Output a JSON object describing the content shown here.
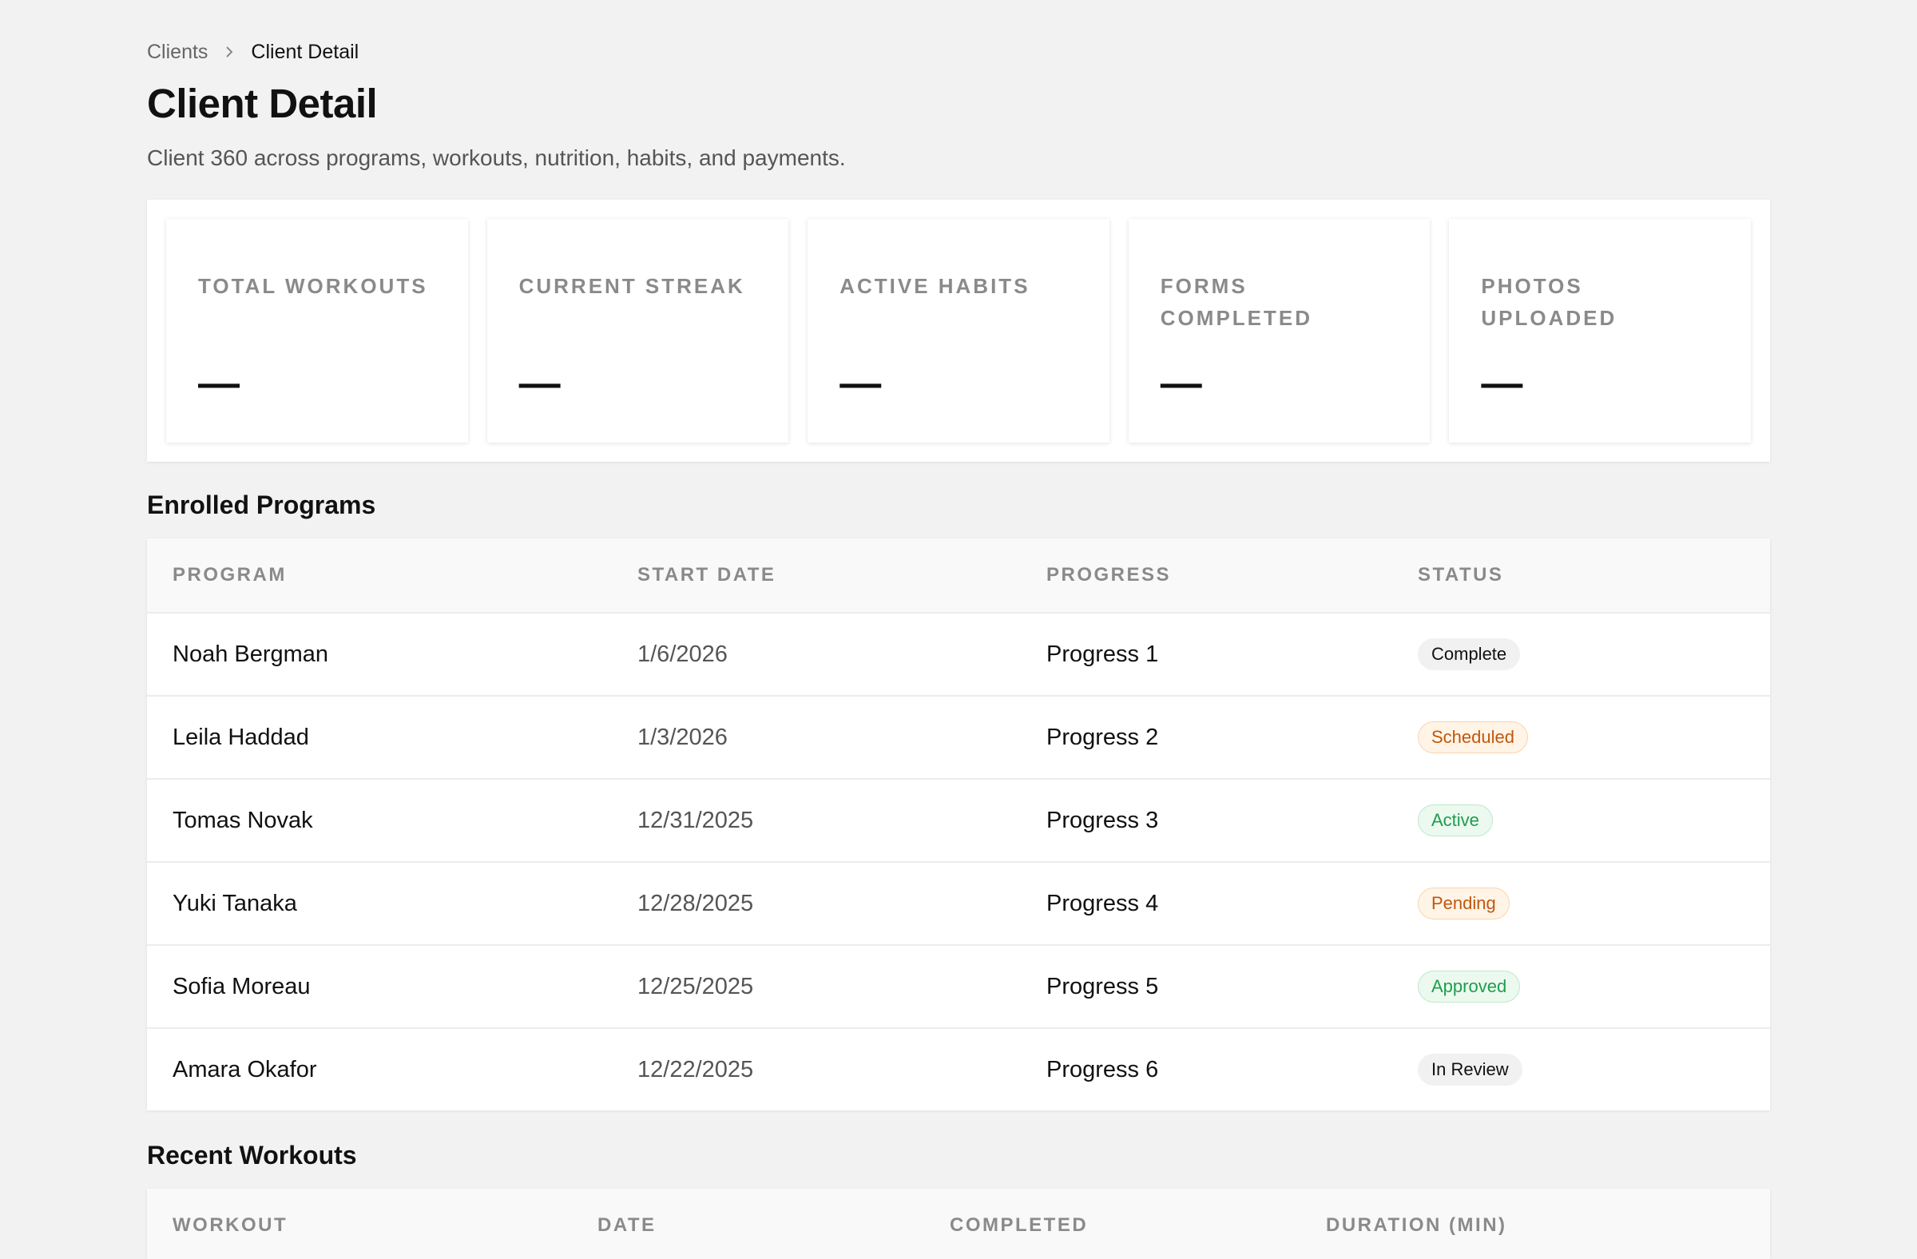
{
  "breadcrumb": {
    "parent": "Clients",
    "current": "Client Detail"
  },
  "page": {
    "title": "Client Detail",
    "subtitle": "Client 360 across programs, workouts, nutrition, habits, and payments."
  },
  "stats": [
    {
      "label": "TOTAL WORKOUTS",
      "value": "—"
    },
    {
      "label": "CURRENT STREAK",
      "value": "—"
    },
    {
      "label": "ACTIVE HABITS",
      "value": "—"
    },
    {
      "label": "FORMS COMPLETED",
      "value": "—"
    },
    {
      "label": "PHOTOS UPLOADED",
      "value": "—"
    }
  ],
  "programs": {
    "title": "Enrolled Programs",
    "columns": [
      "PROGRAM",
      "START DATE",
      "PROGRESS",
      "STATUS"
    ],
    "rows": [
      {
        "program": "Noah Bergman",
        "start": "1/6/2026",
        "progress": "Progress 1",
        "status": "Complete"
      },
      {
        "program": "Leila Haddad",
        "start": "1/3/2026",
        "progress": "Progress 2",
        "status": "Scheduled"
      },
      {
        "program": "Tomas Novak",
        "start": "12/31/2025",
        "progress": "Progress 3",
        "status": "Active"
      },
      {
        "program": "Yuki Tanaka",
        "start": "12/28/2025",
        "progress": "Progress 4",
        "status": "Pending"
      },
      {
        "program": "Sofia Moreau",
        "start": "12/25/2025",
        "progress": "Progress 5",
        "status": "Approved"
      },
      {
        "program": "Amara Okafor",
        "start": "12/22/2025",
        "progress": "Progress 6",
        "status": "In Review"
      }
    ]
  },
  "workouts": {
    "title": "Recent Workouts",
    "columns": [
      "WORKOUT",
      "DATE",
      "COMPLETED",
      "DURATION (MIN)"
    ]
  },
  "colors": {
    "neutral_badge_bg": "#f1f1f1",
    "orange_badge_text": "#c2570c",
    "green_badge_text": "#1f9d4c"
  }
}
